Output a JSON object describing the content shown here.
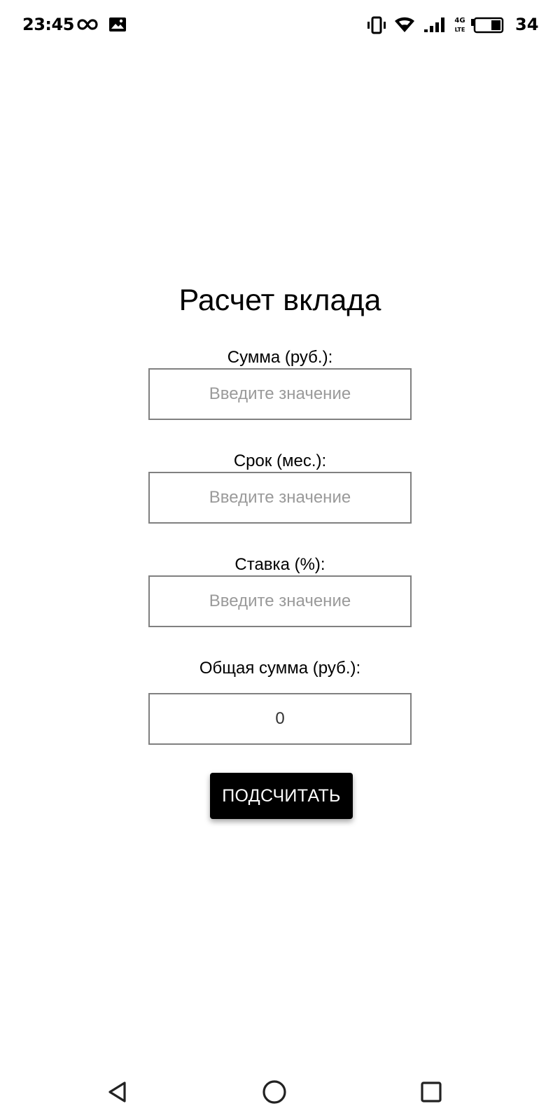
{
  "status_bar": {
    "time": "23:45",
    "battery_level": "34",
    "icons": [
      "infinity-icon",
      "image-notification-icon",
      "vibrate-icon",
      "wifi-icon",
      "signal-icon",
      "4g-lte-icon",
      "battery-icon"
    ]
  },
  "form": {
    "title": "Расчет вклада",
    "amount": {
      "label": "Сумма (руб.):",
      "value": "",
      "placeholder": "Введите значение"
    },
    "term": {
      "label": "Срок (мес.):",
      "value": "",
      "placeholder": "Введите значение"
    },
    "rate": {
      "label": "Ставка (%):",
      "value": "",
      "placeholder": "Введите значение"
    },
    "total": {
      "label": "Общая сумма (руб.):",
      "value": "0"
    },
    "calculate_button": "ПОДСЧИТАТЬ"
  },
  "nav_bar": {
    "icons": [
      "back-icon",
      "home-icon",
      "recents-icon"
    ]
  },
  "colors": {
    "background": "#ffffff",
    "text": "#000000",
    "border": "#808080",
    "placeholder": "#9a9a9a",
    "button_bg": "#000000",
    "button_text": "#ffffff"
  }
}
